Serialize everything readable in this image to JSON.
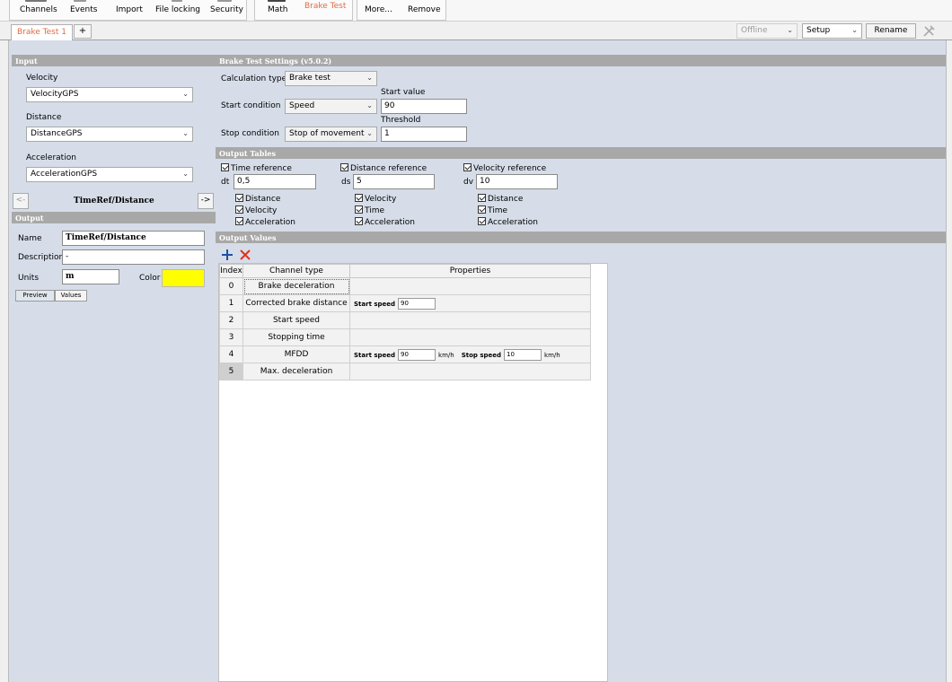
{
  "toolbar": {
    "channels": "Channels",
    "events": "Events",
    "import": "Import",
    "file_locking": "File locking",
    "security": "Security",
    "math": "Math",
    "brake_test": "Brake Test",
    "more": "More...",
    "remove": "Remove"
  },
  "tabs": {
    "doc_tab": "Brake Test 1",
    "add_tab": "+",
    "mode_value": "Offline",
    "view_value": "Setup",
    "rename": "Rename"
  },
  "input_panel": {
    "header": "Input",
    "velocity_label": "Velocity",
    "velocity_value": "VelocityGPS",
    "distance_label": "Distance",
    "distance_value": "DistanceGPS",
    "acceleration_label": "Acceleration",
    "acceleration_value": "AccelerationGPS",
    "prev": "<-",
    "next": "->",
    "current_output": "TimeRef/Distance"
  },
  "output_panel": {
    "header": "Output",
    "name_label": "Name",
    "name_value": "TimeRef/Distance",
    "description_label": "Description",
    "description_value": "-",
    "units_label": "Units",
    "units_value": "m",
    "color_label": "Color",
    "color_value": "#ffff00",
    "preview_tab": "Preview",
    "values_tab": "Values"
  },
  "settings": {
    "header": "Brake Test Settings  (v5.0.2)",
    "calc_type_label": "Calculation type",
    "calc_type_value": "Brake test",
    "start_condition_label": "Start condition",
    "start_condition_value": "Speed",
    "start_value_label": "Start value",
    "start_value": "90",
    "stop_condition_label": "Stop condition",
    "stop_condition_value": "Stop of movement",
    "threshold_label": "Threshold",
    "threshold_value": "1"
  },
  "output_tables": {
    "header": "Output Tables",
    "time_ref": "Time reference",
    "dist_ref": "Distance reference",
    "vel_ref": "Velocity reference",
    "dt_label": "dt",
    "dt_value": "0,5",
    "ds_label": "ds",
    "ds_value": "5",
    "dv_label": "dv",
    "dv_value": "10",
    "col1": [
      "Distance",
      "Velocity",
      "Acceleration"
    ],
    "col2": [
      "Velocity",
      "Time",
      "Acceleration"
    ],
    "col3": [
      "Distance",
      "Time",
      "Acceleration"
    ]
  },
  "output_values": {
    "header": "Output Values",
    "columns": [
      "Index",
      "Channel type",
      "Properties"
    ],
    "rows": [
      {
        "index": "0",
        "type": "Brake deceleration"
      },
      {
        "index": "1",
        "type": "Corrected brake distance"
      },
      {
        "index": "2",
        "type": "Start speed"
      },
      {
        "index": "3",
        "type": "Stopping time"
      },
      {
        "index": "4",
        "type": "MFDD"
      },
      {
        "index": "5",
        "type": "Max. deceleration"
      }
    ],
    "start_speed_label": "Start speed",
    "stop_speed_label": "Stop speed",
    "row1_start_speed": "90",
    "row4_start_speed": "90",
    "row4_stop_speed": "10",
    "unit": "km/h"
  },
  "colors": {
    "accent": "#e06a40",
    "panel_bg": "#d6dde9",
    "header_bg": "#a8a8a8",
    "add_icon": "#1f4fa3",
    "delete_icon": "#e0321e"
  }
}
